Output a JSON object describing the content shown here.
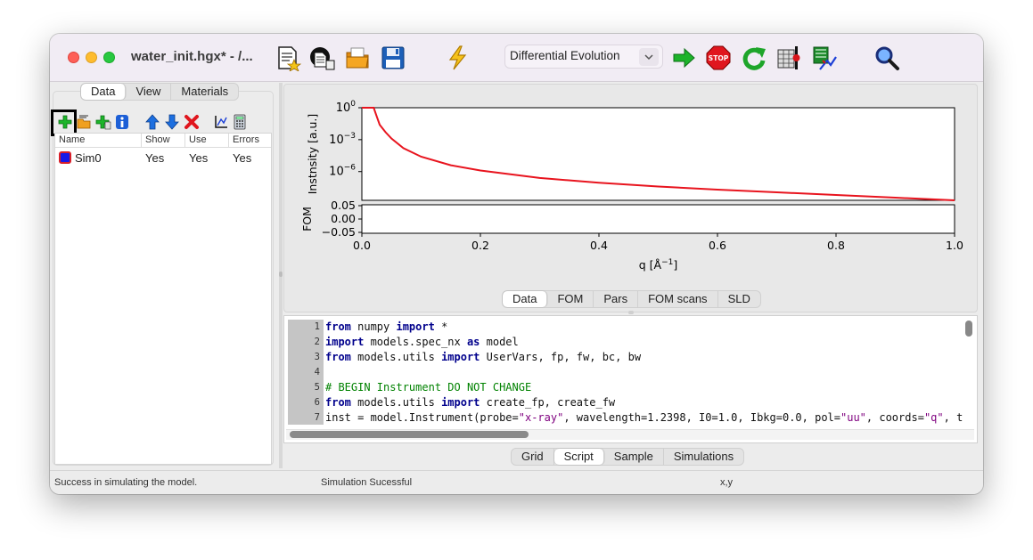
{
  "window": {
    "title": "water_init.hgx* - /..."
  },
  "toolbar": {
    "icons": [
      "new-model-icon",
      "open-icon",
      "open-folder-icon",
      "save-icon",
      "simulate-lightning-icon",
      "start-fit-arrow-icon",
      "stop-icon",
      "restart-fit-icon",
      "calculate-errors-icon",
      "plot-settings-icon",
      "zoom-icon"
    ],
    "algorithm": "Differential Evolution"
  },
  "left_tabs": [
    "Data",
    "View",
    "Materials"
  ],
  "data_toolbar": {
    "icons": [
      "add-data-icon",
      "import-data-icon",
      "add-simulation-icon",
      "info-icon",
      "move-up-icon",
      "move-down-icon",
      "delete-icon",
      "plot-settings-icon",
      "calculator-icon"
    ]
  },
  "data_grid": {
    "columns": [
      "Name",
      "Show",
      "Use",
      "Errors"
    ],
    "rows": [
      {
        "name": "Sim0",
        "show": "Yes",
        "use": "Yes",
        "errors": "Yes",
        "color_fill": "#1818e8",
        "color_edge": "#d8202a"
      }
    ]
  },
  "plot": {
    "top_ylabel": "Instnsity [a.u.]",
    "top_yticks": [
      {
        "base": "10",
        "exp": "0",
        "value": 0
      },
      {
        "base": "10",
        "exp": "−3",
        "value": -3
      },
      {
        "base": "10",
        "exp": "−6",
        "value": -6
      }
    ],
    "bottom_ylabel": "FOM",
    "bottom_yticks": [
      "0.05",
      "0.00",
      "−0.05"
    ],
    "xticks": [
      "0.0",
      "0.2",
      "0.4",
      "0.6",
      "0.8",
      "1.0"
    ],
    "xlabel_text": "q [Å",
    "xlabel_sup": "−1",
    "xlabel_close": "]",
    "line_color": "#e8141e"
  },
  "chart_data": {
    "type": "line",
    "series": [
      {
        "x": [
          0.0,
          0.02,
          0.025,
          0.03,
          0.04,
          0.05,
          0.07,
          0.1,
          0.15,
          0.2,
          0.3,
          0.4,
          0.5,
          0.6,
          0.7,
          0.8,
          0.9,
          1.0
        ],
        "log10_y": [
          0.0,
          0.0,
          -0.8,
          -1.6,
          -2.3,
          -2.9,
          -3.8,
          -4.6,
          -5.4,
          -5.9,
          -6.6,
          -7.05,
          -7.4,
          -7.7,
          -7.95,
          -8.2,
          -8.45,
          -8.7
        ]
      }
    ],
    "xlabel": "q [Å⁻¹]",
    "ylabel": "Instnsity [a.u.]",
    "xlim": [
      0.0,
      1.0
    ],
    "ylim_log10": [
      -8.7,
      0.0
    ],
    "yscale": "log"
  },
  "plot_tabs": [
    "Data",
    "FOM",
    "Pars",
    "FOM scans",
    "SLD"
  ],
  "script": {
    "lines": [
      {
        "n": "1",
        "parts": [
          {
            "t": "from",
            "c": "kw"
          },
          {
            "t": " numpy ",
            "c": ""
          },
          {
            "t": "import",
            "c": "kw"
          },
          {
            "t": " *",
            "c": ""
          }
        ]
      },
      {
        "n": "2",
        "parts": [
          {
            "t": "import",
            "c": "kw"
          },
          {
            "t": " models.spec_nx ",
            "c": ""
          },
          {
            "t": "as",
            "c": "kw"
          },
          {
            "t": " model",
            "c": ""
          }
        ]
      },
      {
        "n": "3",
        "parts": [
          {
            "t": "from",
            "c": "kw"
          },
          {
            "t": " models.utils ",
            "c": ""
          },
          {
            "t": "import",
            "c": "kw"
          },
          {
            "t": " UserVars, fp, fw, bc, bw",
            "c": ""
          }
        ]
      },
      {
        "n": "4",
        "parts": [
          {
            "t": "",
            "c": ""
          }
        ]
      },
      {
        "n": "5",
        "parts": [
          {
            "t": "# BEGIN Instrument DO NOT CHANGE",
            "c": "cmt"
          }
        ]
      },
      {
        "n": "6",
        "parts": [
          {
            "t": "from",
            "c": "kw"
          },
          {
            "t": " models.utils ",
            "c": ""
          },
          {
            "t": "import",
            "c": "kw"
          },
          {
            "t": " create_fp, create_fw",
            "c": ""
          }
        ]
      },
      {
        "n": "7",
        "parts": [
          {
            "t": "inst = model.Instrument(probe=",
            "c": ""
          },
          {
            "t": "\"x-ray\"",
            "c": "str"
          },
          {
            "t": ", wavelength=1.2398, I0=1.0, Ibkg=0.0, pol=",
            "c": ""
          },
          {
            "t": "\"uu\"",
            "c": "str"
          },
          {
            "t": ", coords=",
            "c": ""
          },
          {
            "t": "\"q\"",
            "c": "str"
          },
          {
            "t": ", t",
            "c": ""
          }
        ]
      }
    ]
  },
  "script_tabs": [
    "Grid",
    "Script",
    "Sample",
    "Simulations"
  ],
  "status": {
    "left": "Success in simulating the model.",
    "middle": "Simulation Sucessful",
    "right": "x,y"
  }
}
